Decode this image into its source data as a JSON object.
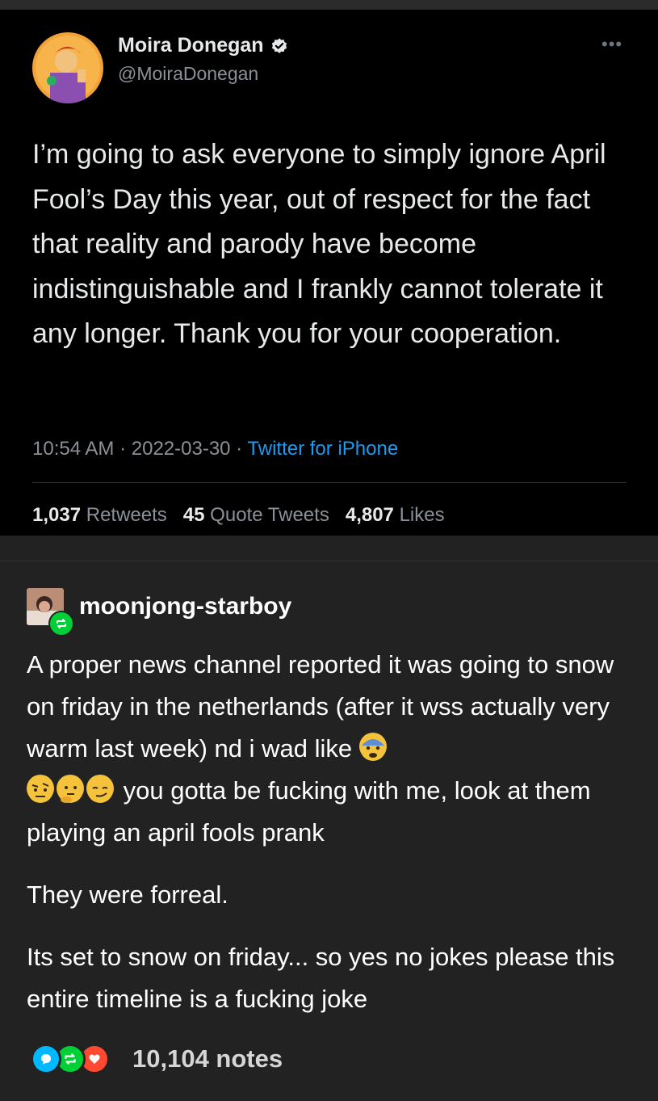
{
  "tweet": {
    "display_name": "Moira Donegan",
    "handle": "@MoiraDonegan",
    "text": "I’m going to ask everyone to simply ignore April Fool’s Day this year, out of respect for the fact that reality and parody have become indistinguishable and I frankly cannot tolerate it any longer. Thank you for your cooperation.",
    "time": "10:54 AM",
    "date": "2022-03-30",
    "source": "Twitter for iPhone",
    "retweets_count": "1,037",
    "retweets_label": "Retweets",
    "quotes_count": "45",
    "quotes_label": "Quote Tweets",
    "likes_count": "4,807",
    "likes_label": "Likes",
    "more_icon": "more-icon",
    "verified_icon": "verified-badge-icon"
  },
  "reblog": {
    "username": "moonjong-starboy",
    "paragraph1_a": "A proper news channel reported it was going to snow on friday in the netherlands (after it wss actually very warm last week) nd i wad like",
    "paragraph1_b": "you gotta be fucking with me, look at them playing an april fools prank",
    "paragraph2": "They were forreal.",
    "paragraph3": "Its set to snow on friday... so yes no jokes please this entire timeline is a fucking joke",
    "emojis": [
      "anxious-face-emoji",
      "raised-eyebrow-face-emoji",
      "thinking-face-emoji",
      "smirking-face-emoji"
    ]
  },
  "notes": {
    "count_label": "10,104 notes",
    "icons": [
      "reply-icon",
      "reblog-icon",
      "like-icon"
    ]
  },
  "colors": {
    "tweet_bg": "#000000",
    "page_bg": "#222222",
    "twitter_blue": "#1d9bf0",
    "tumblr_green": "#00cf35",
    "tumblr_red": "#ff4930",
    "tumblr_blue": "#00b8ff"
  }
}
